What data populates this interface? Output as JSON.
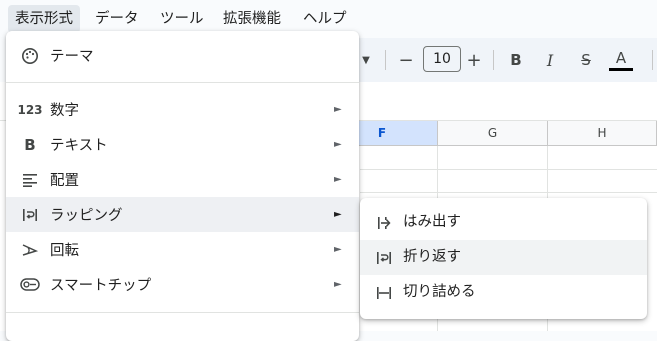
{
  "menubar": {
    "items": [
      {
        "label": "表示形式",
        "active": true
      },
      {
        "label": "データ"
      },
      {
        "label": "ツール"
      },
      {
        "label": "拡張機能"
      },
      {
        "label": "ヘルプ"
      }
    ]
  },
  "toolbar": {
    "font_size": "10",
    "minus": "−",
    "plus": "+",
    "bold": "B",
    "italic": "I",
    "strikethrough": "S",
    "text_color": "A"
  },
  "columns": [
    "F",
    "G",
    "H"
  ],
  "format_menu": {
    "items": [
      {
        "label": "テーマ",
        "icon": "palette-icon"
      },
      {
        "label": "数字",
        "icon": "number-format-icon",
        "icon_text": "123"
      },
      {
        "label": "テキスト",
        "icon": "bold-icon",
        "icon_text": "B"
      },
      {
        "label": "配置",
        "icon": "align-icon"
      },
      {
        "label": "ラッピング",
        "icon": "wrap-icon"
      },
      {
        "label": "回転",
        "icon": "rotate-icon"
      },
      {
        "label": "スマートチップ",
        "icon": "smart-chip-icon"
      }
    ],
    "submenu_arrow": "►"
  },
  "wrap_submenu": {
    "items": [
      {
        "label": "はみ出す",
        "icon": "overflow-icon"
      },
      {
        "label": "折り返す",
        "icon": "wrap-icon"
      },
      {
        "label": "切り詰める",
        "icon": "clip-icon"
      }
    ]
  },
  "colors": {
    "selected_column": "#d3e3fd",
    "menu_hover": "#eef0f3"
  }
}
